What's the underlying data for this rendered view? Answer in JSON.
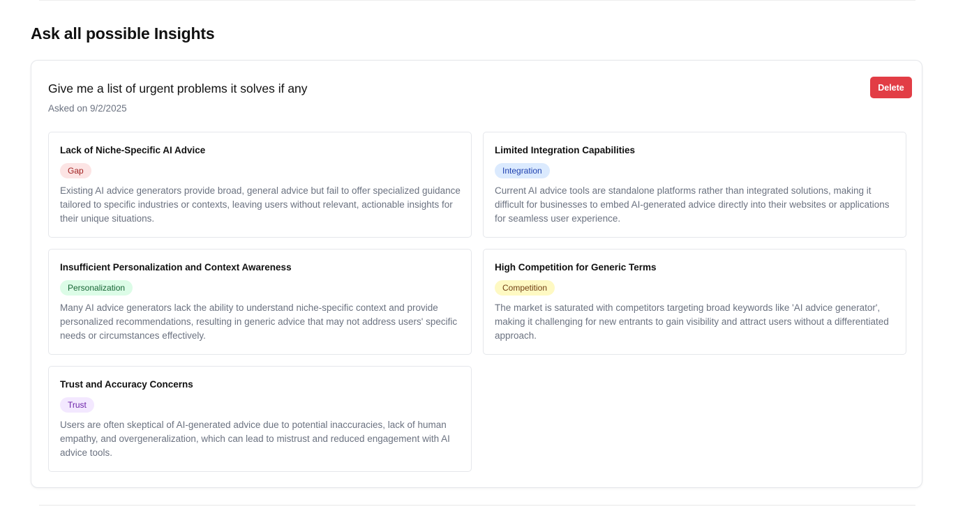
{
  "page": {
    "title": "Ask all possible Insights"
  },
  "question": {
    "title": "Give me a list of urgent problems it solves if any",
    "asked_on": "Asked on 9/2/2025",
    "delete_label": "Delete",
    "delete_color": "#e23d45"
  },
  "insights": [
    {
      "title": "Lack of Niche-Specific AI Advice",
      "tag": "Gap",
      "tag_bg": "#fce4e4",
      "tag_fg": "#9f1d1d",
      "description": "Existing AI advice generators provide broad, general advice but fail to offer specialized guidance tailored to specific industries or contexts, leaving users without relevant, actionable insights for their unique situations."
    },
    {
      "title": "Limited Integration Capabilities",
      "tag": "Integration",
      "tag_bg": "#dbeafe",
      "tag_fg": "#1e40af",
      "description": "Current AI advice tools are standalone platforms rather than integrated solutions, making it difficult for businesses to embed AI-generated advice directly into their websites or applications for seamless user experience."
    },
    {
      "title": "Insufficient Personalization and Context Awareness",
      "tag": "Personalization",
      "tag_bg": "#dcfce7",
      "tag_fg": "#166534",
      "description": "Many AI advice generators lack the ability to understand niche-specific context and provide personalized recommendations, resulting in generic advice that may not address users' specific needs or circumstances effectively."
    },
    {
      "title": "High Competition for Generic Terms",
      "tag": "Competition",
      "tag_bg": "#fef9c3",
      "tag_fg": "#713f12",
      "description": "The market is saturated with competitors targeting broad keywords like 'AI advice generator', making it challenging for new entrants to gain visibility and attract users without a differentiated approach."
    },
    {
      "title": "Trust and Accuracy Concerns",
      "tag": "Trust",
      "tag_bg": "#f3e8ff",
      "tag_fg": "#6b21a8",
      "description": "Users are often skeptical of AI-generated advice due to potential inaccuracies, lack of human empathy, and overgeneralization, which can lead to mistrust and reduced engagement with AI advice tools."
    }
  ]
}
